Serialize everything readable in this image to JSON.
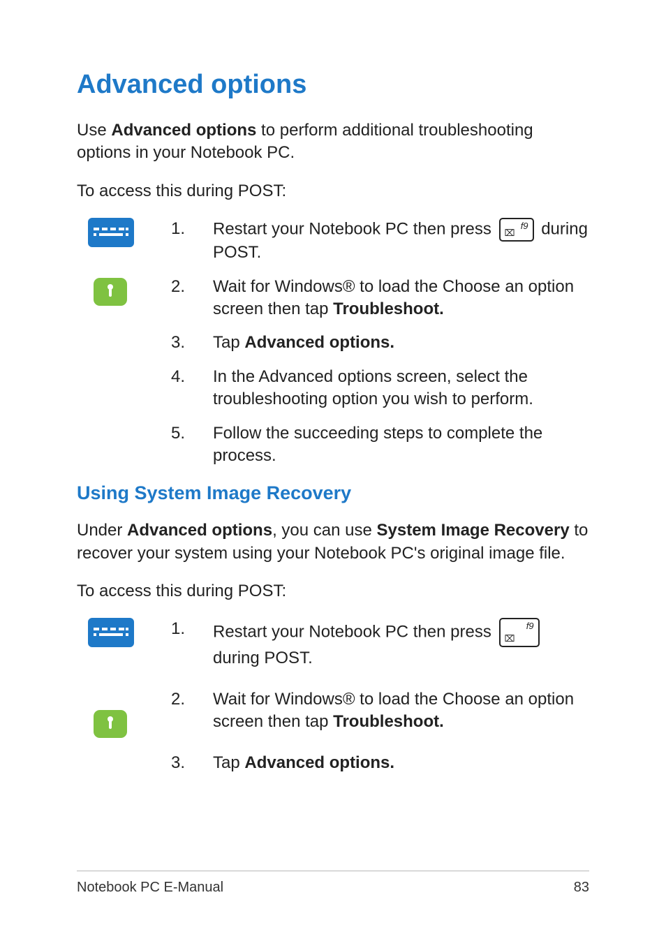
{
  "title": "Advanced options",
  "intro_parts": {
    "a": "Use ",
    "b": "Advanced options",
    "c": " to perform additional troubleshooting options in your Notebook PC."
  },
  "access_line": "To access this during POST:",
  "key": {
    "fn": "f9",
    "glyph": "⌧"
  },
  "steps_a": [
    {
      "n": "1.",
      "pre": "Restart your Notebook PC then press ",
      "has_key": true,
      "post": " during POST."
    },
    {
      "n": "2.",
      "pre": "Wait for Windows® to load the Choose an option screen then tap ",
      "bold": "Troubleshoot."
    },
    {
      "n": "3.",
      "pre": "Tap ",
      "bold": "Advanced options."
    },
    {
      "n": "4.",
      "pre": "In the Advanced options screen, select the troubleshooting option you wish to perform."
    },
    {
      "n": "5.",
      "pre": "Follow the succeeding steps to complete the process."
    }
  ],
  "subheading": "Using System Image Recovery",
  "intro2_parts": {
    "a": "Under ",
    "b": "Advanced options",
    "c": ", you can use ",
    "d": "System Image Recovery",
    "e": " to recover your system using your Notebook PC's original image file."
  },
  "steps_b": [
    {
      "n": "1.",
      "pre": "Restart your Notebook PC then press ",
      "has_key": true,
      "post": " during POST."
    },
    {
      "n": "2.",
      "pre": "Wait for Windows® to load the Choose an option screen then tap ",
      "bold": "Troubleshoot."
    },
    {
      "n": "3.",
      "pre": "Tap ",
      "bold": "Advanced options."
    }
  ],
  "footer": {
    "left": "Notebook PC E-Manual",
    "right": "83"
  }
}
